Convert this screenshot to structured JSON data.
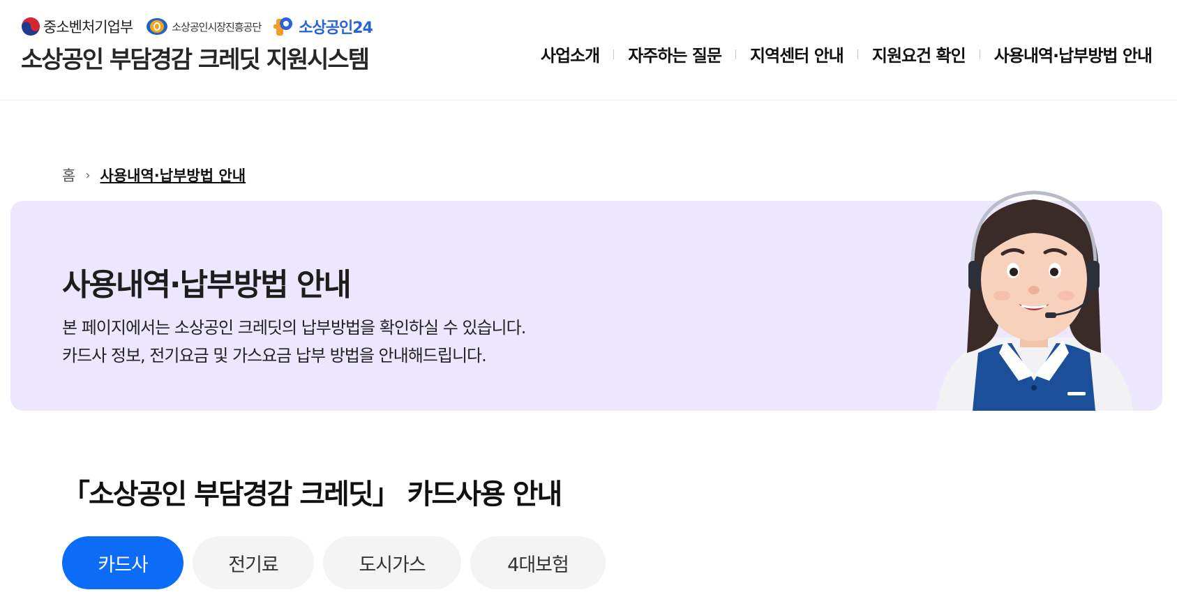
{
  "header": {
    "agencies": [
      {
        "name": "중소벤처기업부",
        "icon": "taegeuk-emblem-icon"
      },
      {
        "name": "소상공인시장진흥공단",
        "icon": "semas-logo-icon"
      },
      {
        "name": "소상공인24",
        "icon": "sosanggongin24-logo-icon"
      }
    ],
    "site_title": "소상공인 부담경감 크레딧 지원시스템",
    "nav": [
      {
        "label": "사업소개"
      },
      {
        "label": "자주하는 질문"
      },
      {
        "label": "지역센터 안내"
      },
      {
        "label": "지원요건 확인"
      },
      {
        "label": "사용내역·납부방법 안내"
      }
    ]
  },
  "breadcrumb": {
    "home": "홈",
    "current": "사용내역·납부방법 안내"
  },
  "hero": {
    "title": "사용내역·납부방법 안내",
    "desc_line1": "본 페이지에서는 소상공인 크레딧의 납부방법을 확인하실 수 있습니다.",
    "desc_line2": "카드사 정보, 전기요금 및 가스요금 납부 방법을 안내해드립니다.",
    "illustration": "call-center-agent-illustration"
  },
  "section": {
    "title": "「소상공인 부담경감 크레딧」 카드사용 안내",
    "tabs": [
      {
        "label": "카드사",
        "active": true
      },
      {
        "label": "전기료",
        "active": false
      },
      {
        "label": "도시가스",
        "active": false
      },
      {
        "label": "4대보험",
        "active": false
      }
    ]
  },
  "colors": {
    "accent": "#0d6cf5",
    "hero_bg": "#ece7fd",
    "tab_bg": "#f4f4f4",
    "logo_blue": "#2a63d6"
  }
}
